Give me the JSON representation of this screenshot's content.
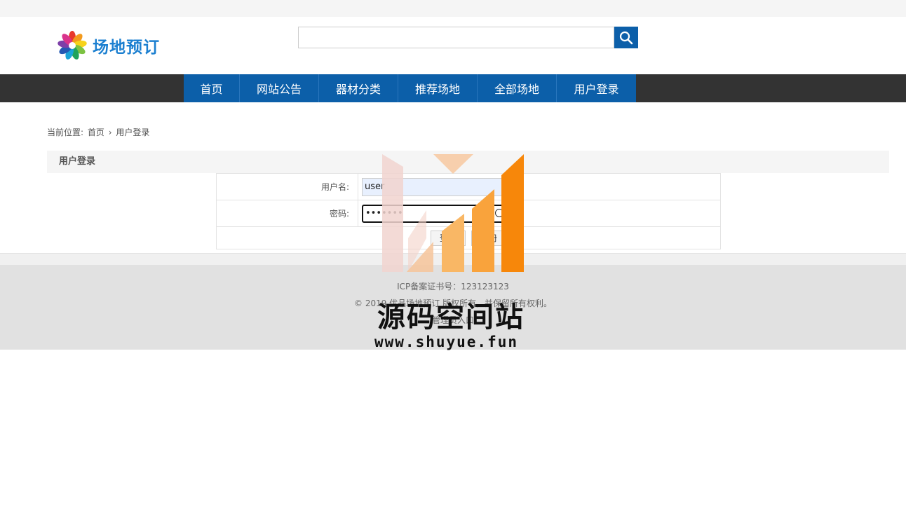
{
  "header": {
    "logo_text": "场地预订",
    "search_placeholder": "",
    "search_value": ""
  },
  "nav": {
    "items": [
      {
        "label": "首页",
        "width": 80
      },
      {
        "label": "网站公告",
        "width": 113
      },
      {
        "label": "器材分类",
        "width": 113
      },
      {
        "label": "推荐场地",
        "width": 113
      },
      {
        "label": "全部场地",
        "width": 113
      },
      {
        "label": "用户登录",
        "width": 113
      }
    ]
  },
  "breadcrumb": {
    "prefix": "当前位置:",
    "home": "首页",
    "separator": "›",
    "current": "用户登录"
  },
  "panel": {
    "title": "用户登录"
  },
  "login": {
    "username_label": "用户名:",
    "username_value": "user",
    "password_label": "密码:",
    "password_value": "•••••••",
    "login_button": "登录",
    "register_button": "注册"
  },
  "footer": {
    "icp": "ICP备案证书号：123123123",
    "copyright": "© 2019 优品场地预订 版权所有，并保留所有权利。",
    "admin_link": "管理员入口"
  },
  "watermark": {
    "title": "源码空间站",
    "url": "www.shuyue.fun"
  },
  "colors": {
    "primary": "#0c5fa9",
    "nav_bg": "#333333",
    "footer_bg": "#e1e1e1",
    "watermark_orange": "#f7870a"
  }
}
